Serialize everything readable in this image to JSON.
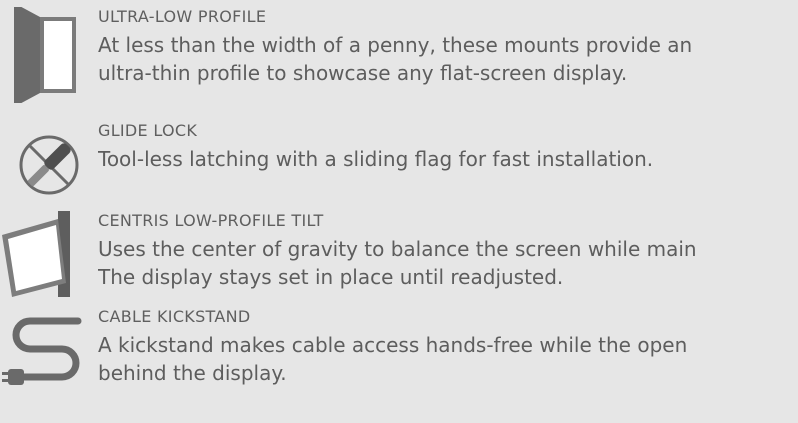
{
  "features": [
    {
      "icon": "ultra-low-profile-icon",
      "title": "ULTRA-LOW PROFILE",
      "desc_lines": [
        "At less than the width of a penny, these mounts provide an",
        "ultra-thin profile to showcase any flat-screen display."
      ]
    },
    {
      "icon": "glide-lock-icon",
      "title": "GLIDE LOCK",
      "desc_lines": [
        "Tool-less latching with a sliding flag for fast installation."
      ]
    },
    {
      "icon": "tilt-icon",
      "title": "CENTRIS LOW-PROFILE TILT",
      "desc_lines": [
        "Uses the center of gravity to balance the screen while main",
        "The display stays set in place until readjusted."
      ]
    },
    {
      "icon": "cable-kickstand-icon",
      "title": "CABLE KICKSTAND",
      "desc_lines": [
        "A kickstand makes cable access hands-free while the open",
        "behind the display."
      ]
    }
  ],
  "colors": {
    "background": "#e6e6e6",
    "text": "#5d5d5d",
    "icon_dark": "#6a6a6a"
  }
}
